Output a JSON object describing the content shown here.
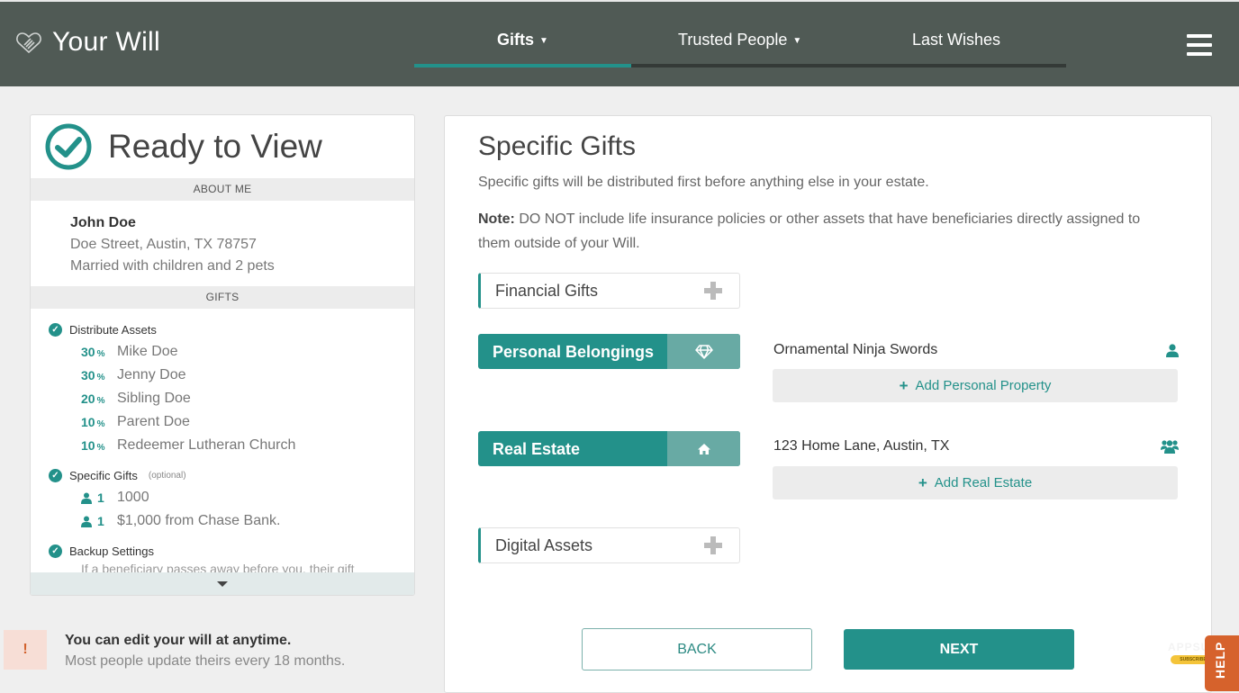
{
  "header": {
    "app_title": "Your Will",
    "logo_icon": "heart-hand-icon",
    "nav": [
      {
        "label": "Gifts",
        "has_dropdown": true,
        "active": true
      },
      {
        "label": "Trusted People",
        "has_dropdown": true,
        "active": false
      },
      {
        "label": "Last Wishes",
        "has_dropdown": false,
        "active": false
      }
    ],
    "progress_fraction": 0.333,
    "menu_icon": "hamburger-menu-icon"
  },
  "summary": {
    "status_title": "Ready to View",
    "status_icon": "check-circle-icon",
    "about_heading": "ABOUT ME",
    "about": {
      "name": "John Doe",
      "address": "Doe Street, Austin, TX 78757",
      "family": "Married with children and 2 pets"
    },
    "gifts_heading": "GIFTS",
    "distribute": {
      "title": "Distribute Assets",
      "beneficiaries": [
        {
          "percent": "30",
          "name": "Mike Doe"
        },
        {
          "percent": "30",
          "name": "Jenny Doe"
        },
        {
          "percent": "20",
          "name": "Sibling Doe"
        },
        {
          "percent": "10",
          "name": "Parent Doe"
        },
        {
          "percent": "10",
          "name": "Redeemer Lutheran Church"
        }
      ]
    },
    "specific_gifts": {
      "title": "Specific Gifts",
      "optional_label": "(optional)",
      "items": [
        {
          "count": "1",
          "text": "1000"
        },
        {
          "count": "1",
          "text": "$1,000 from Chase Bank."
        }
      ]
    },
    "backup": {
      "title": "Backup Settings",
      "cutoff_text": "If a beneficiary passes away before you, their gift"
    },
    "percent_symbol": "%",
    "expand_icon": "caret-down-icon"
  },
  "notice": {
    "badge": "!",
    "title": "You can edit your will at anytime.",
    "subtitle": "Most people update theirs every 18 months."
  },
  "main": {
    "title": "Specific Gifts",
    "description": "Specific gifts will be distributed first before anything else in your estate.",
    "note_label": "Note:",
    "note_text": " DO NOT include life insurance policies or other assets that have beneficiaries directly assigned to them outside of your Will.",
    "categories": [
      {
        "label": "Financial Gifts",
        "state": "collapsed",
        "icon": "plus-icon"
      },
      {
        "label": "Personal Belongings",
        "state": "expanded",
        "icon": "diamond-icon"
      },
      {
        "label": "Real Estate",
        "state": "expanded",
        "icon": "home-icon"
      },
      {
        "label": "Digital Assets",
        "state": "collapsed",
        "icon": "plus-icon"
      }
    ],
    "personal_items": [
      {
        "name": "Ornamental Ninja Swords",
        "icon": "user-icon"
      }
    ],
    "add_personal_label": "Add Personal Property",
    "real_estate_items": [
      {
        "name": "123 Home Lane, Austin, TX",
        "icon": "users-group-icon"
      }
    ],
    "add_real_estate_label": "Add Real Estate",
    "back_label": "BACK",
    "next_label": "NEXT"
  },
  "overlay": {
    "help_label": "HELP",
    "appsumo_label": "APPSUMO",
    "subscribe_label": "SUBSCRIBE"
  },
  "colors": {
    "header_bg": "#505a55",
    "accent": "#23918a",
    "accent_light": "#68aaa4",
    "notice_accent": "#d2622e",
    "help_bg": "#d6622c"
  }
}
